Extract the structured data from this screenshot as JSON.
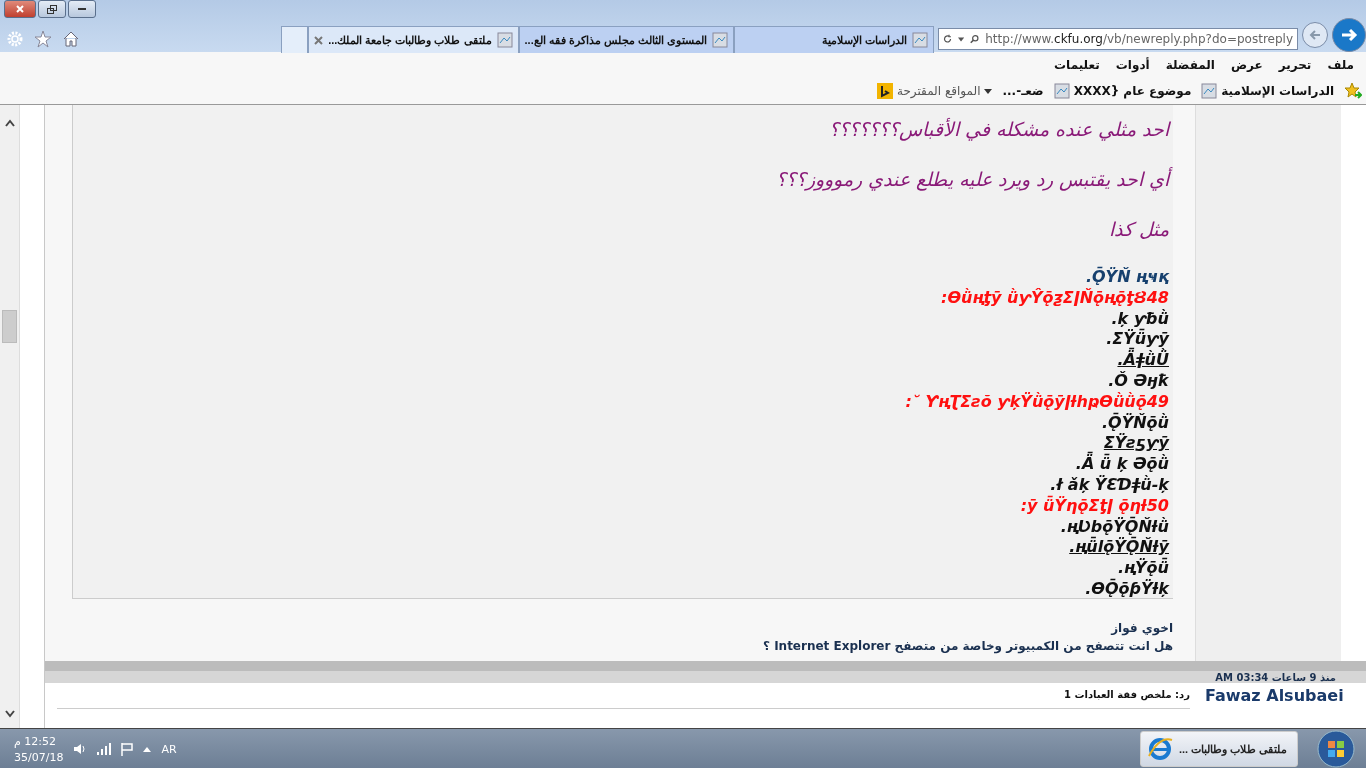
{
  "tabs": [
    {
      "label": "الدراسات الإسلامية",
      "selected": false
    },
    {
      "label": "المستوى الثالث مجلس مذاكرة فقه الع...",
      "selected": false
    },
    {
      "label": "ملتقى طلاب وطالبات جامعة الملك...",
      "selected": true
    }
  ],
  "address": {
    "prefix": "http://www.",
    "host": "ckfu.org",
    "path": "/vb/newreply.php?do=postreply"
  },
  "menu": [
    "ملف",
    "تحرير",
    "عرض",
    "المفضلة",
    "أدوات",
    "تعليمات"
  ],
  "favorites": [
    {
      "kind": "site",
      "label": "الدراسات الإسلامية"
    },
    {
      "kind": "site",
      "label": "موضوع عام {XXXX"
    },
    {
      "kind": "plain",
      "label": "ضعـ-..."
    },
    {
      "kind": "suggested",
      "label": "المواقع المقترحة"
    }
  ],
  "quote": {
    "lines": [
      {
        "kind": "script",
        "text": "احد مثلي عنده مشكله في الأقباس؟؟؟؟؟؟؟"
      },
      {
        "kind": "script",
        "text": "أي احد يقتبس رد ويرد عليه يطلع عندي رموووز؟؟؟"
      },
      {
        "kind": "script",
        "text": "مثل كذا"
      },
      {
        "kind": "blue",
        "underline": false,
        "text": ".ǬŸŇ   ңҹқ"
      },
      {
        "kind": "red",
        "underline": false,
        "text": ":Ɵǜңƫȳ ǜƴŶǭƺƩǀŇǭңǭƫȢ48"
      },
      {
        "kind": "black",
        "underline": false,
        "text": ".ķ ƴƀǜ"
      },
      {
        "kind": "black",
        "underline": false,
        "text": ".ƩŸǖƴȳ"
      },
      {
        "kind": "black",
        "underline": true,
        "text": ".ǞǂǜǛ"
      },
      {
        "kind": "black",
        "underline": false,
        "text": ".Ǒ Əӈҟ"
      },
      {
        "kind": "red",
        "underline": false,
        "text": ":˘   ƳңƮƩƨŏ ƴķŸǜǭȳǀƚhҏƟǜǜǭ49"
      },
      {
        "kind": "black",
        "underline": false,
        "text": ".ǬŸŇǭǜ"
      },
      {
        "kind": "black",
        "underline": true,
        "text": "ƩŸƨƽƴȳ"
      },
      {
        "kind": "black",
        "underline": false,
        "text": ".Ǟ ǖ ķ Əǭǜ"
      },
      {
        "kind": "black",
        "underline": false,
        "text": ".ł ǎķ ŸƐƊǂǜ-ķ"
      },
      {
        "kind": "red",
        "underline": false,
        "text": ":ȳ ǖŸƞǭƩƫǀ ǭƞƚ50"
      },
      {
        "kind": "black",
        "underline": false,
        "text": ".ңƲbǭŸǬŇƚǜ"
      },
      {
        "kind": "black",
        "underline": true,
        "text": ".ңǖlǭŸǬŇƚȳ"
      },
      {
        "kind": "black",
        "underline": false,
        "text": ".ңŸǭǖ"
      },
      {
        "kind": "black",
        "underline": false,
        "text": ".ƟǬǭƥŸƚķ"
      }
    ]
  },
  "reply": [
    "اخوي فواز",
    "هل انت تتصفح من الكمبيوتر وخاصة من متصفح **Internet Explorer** ؟"
  ],
  "post_date": "منذ 9 ساعات 03:34 AM",
  "next_post": {
    "author": "Fawaz Alsubaei",
    "title": "رد: ملخص فقة العبادات 1"
  },
  "taskbar": {
    "app": "ملتقى طلاب وطالبات ...",
    "language": "AR",
    "time": "12:52 م",
    "date": "35/07/18"
  }
}
